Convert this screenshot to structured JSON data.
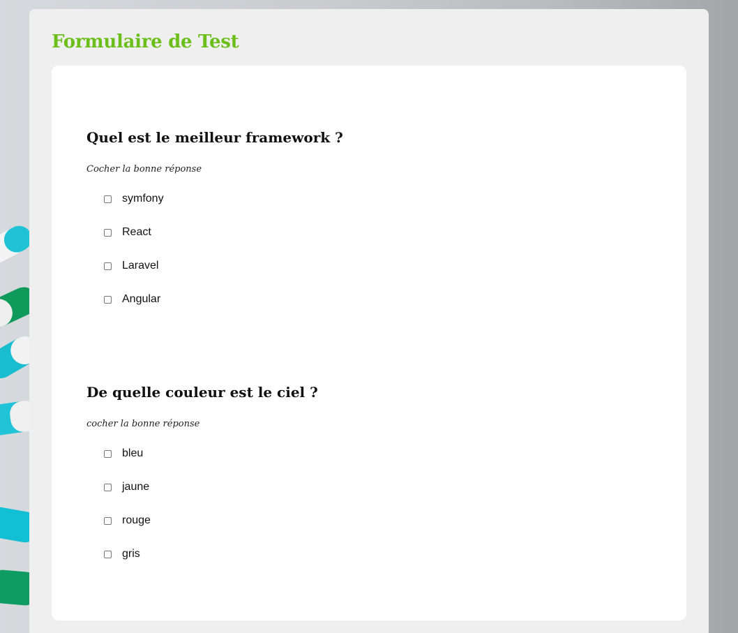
{
  "form": {
    "title": "Formulaire de Test"
  },
  "questions": [
    {
      "title": "Quel est le meilleur framework ?",
      "hint": "Cocher la bonne réponse",
      "options": [
        {
          "label": "symfony",
          "checked": false
        },
        {
          "label": "React",
          "checked": false
        },
        {
          "label": "Laravel",
          "checked": false
        },
        {
          "label": "Angular",
          "checked": false
        }
      ]
    },
    {
      "title": "De quelle couleur est le ciel ?",
      "hint": "cocher la bonne réponse",
      "options": [
        {
          "label": "bleu",
          "checked": false
        },
        {
          "label": "jaune",
          "checked": false
        },
        {
          "label": "rouge",
          "checked": false
        },
        {
          "label": "gris",
          "checked": false
        }
      ]
    }
  ],
  "colors": {
    "title_green": "#6cbf1b",
    "card_bg": "#efefef",
    "panel_bg": "#ffffff"
  }
}
